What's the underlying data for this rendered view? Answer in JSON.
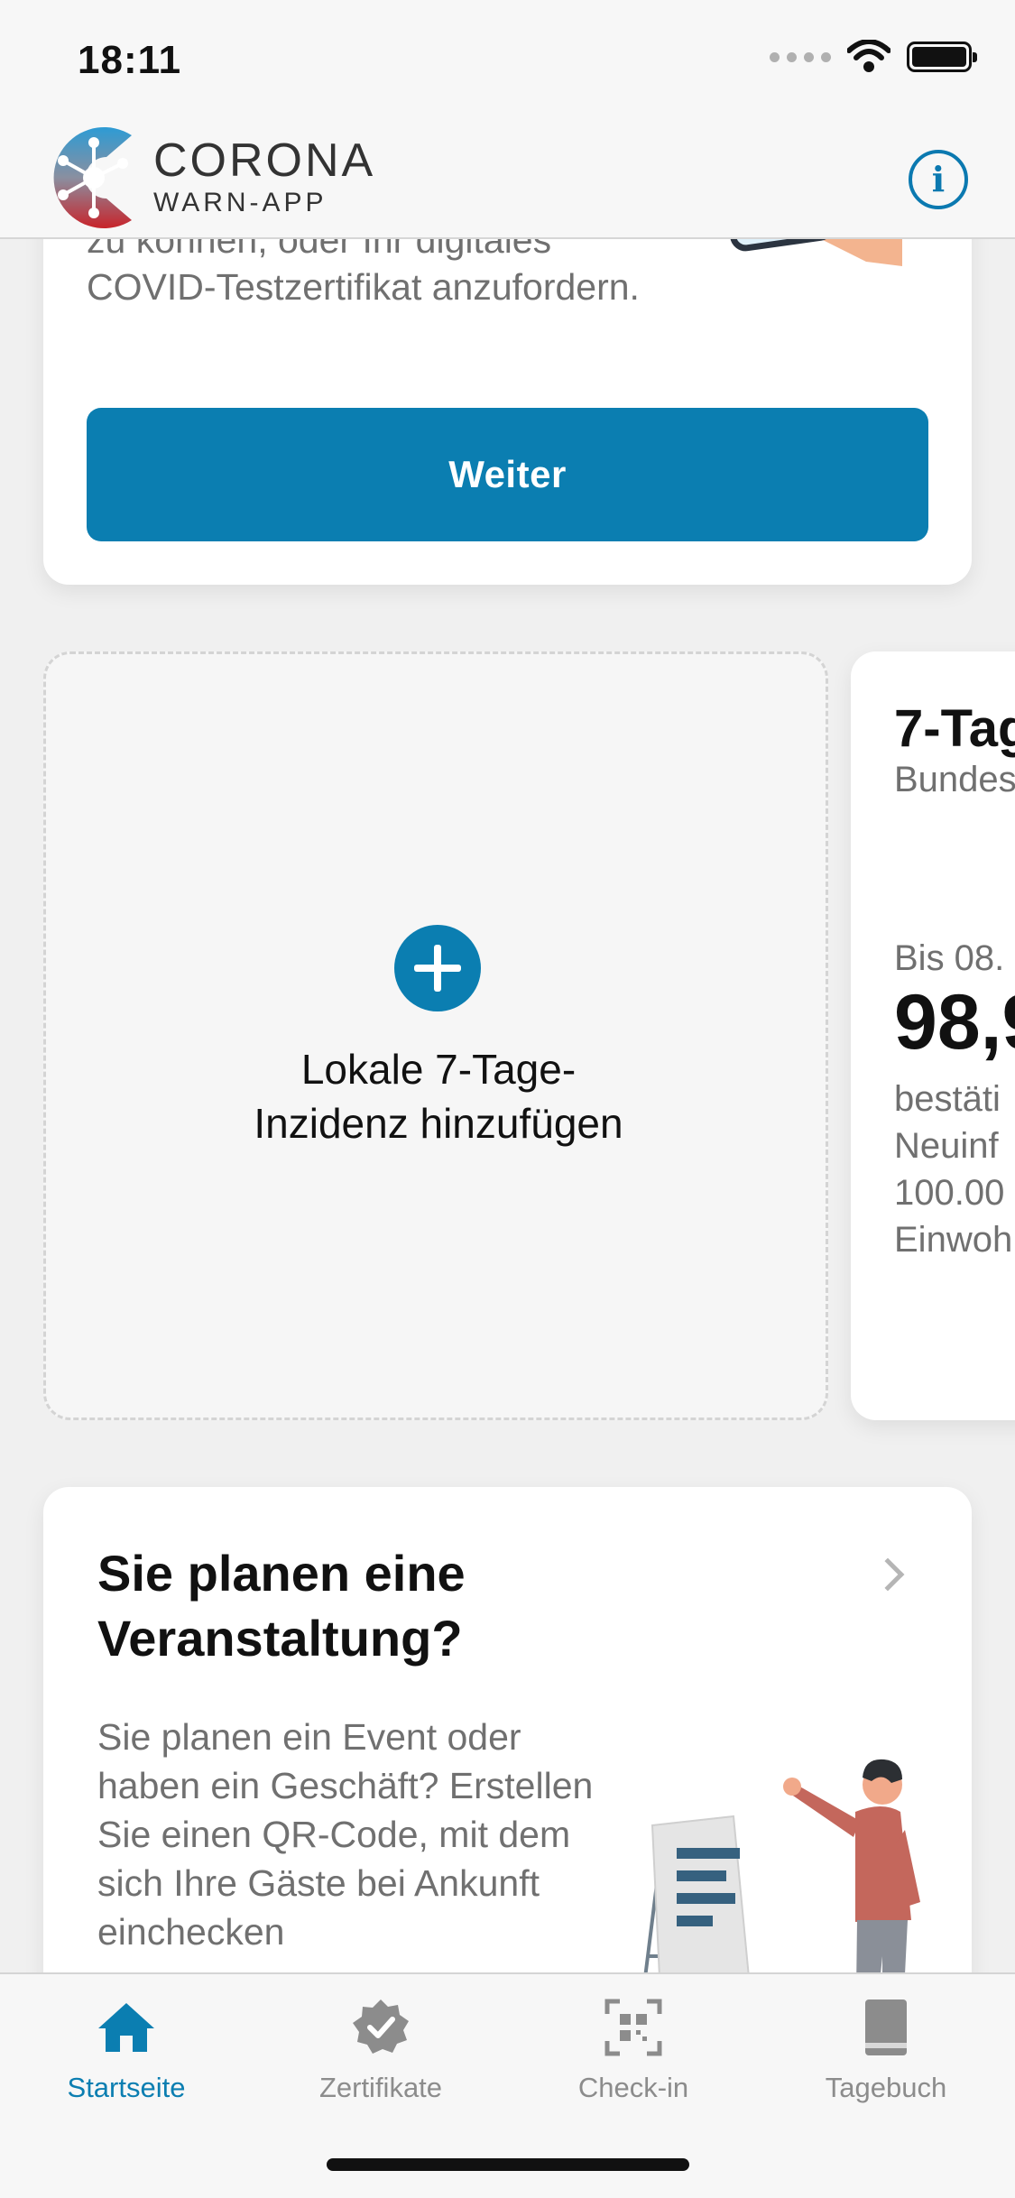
{
  "status": {
    "time": "18:11"
  },
  "header": {
    "logo_title": "CORONA",
    "logo_subtitle": "WARN-APP"
  },
  "test_card": {
    "text": "zu können, oder Ihr digitales COVID-Testzertifikat anzufordern.",
    "button_label": "Weiter"
  },
  "add_incidence": {
    "label": "Lokale 7-Tage-\nInzidenz hinzufügen"
  },
  "incidence_card": {
    "title": "7-Tag",
    "subtitle": "Bundes",
    "date": "Bis 08.",
    "value": "98,9",
    "description": "bestäti\nNeuinf\n100.00\nEinwoh"
  },
  "event_card": {
    "title": "Sie planen eine Veranstaltung?",
    "text": "Sie planen ein Event oder haben ein Geschäft? Erstellen Sie einen QR-Code, mit dem sich Ihre Gäste bei Ankunft einchecken"
  },
  "tabs": [
    {
      "label": "Startseite",
      "icon": "home-icon",
      "active": true
    },
    {
      "label": "Zertifikate",
      "icon": "certificate-icon",
      "active": false
    },
    {
      "label": "Check-in",
      "icon": "qr-scan-icon",
      "active": false
    },
    {
      "label": "Tagebuch",
      "icon": "diary-book-icon",
      "active": false
    }
  ],
  "colors": {
    "accent": "#0b7eb1",
    "logo_red": "#c8242b",
    "logo_blue": "#2d9bd4"
  }
}
